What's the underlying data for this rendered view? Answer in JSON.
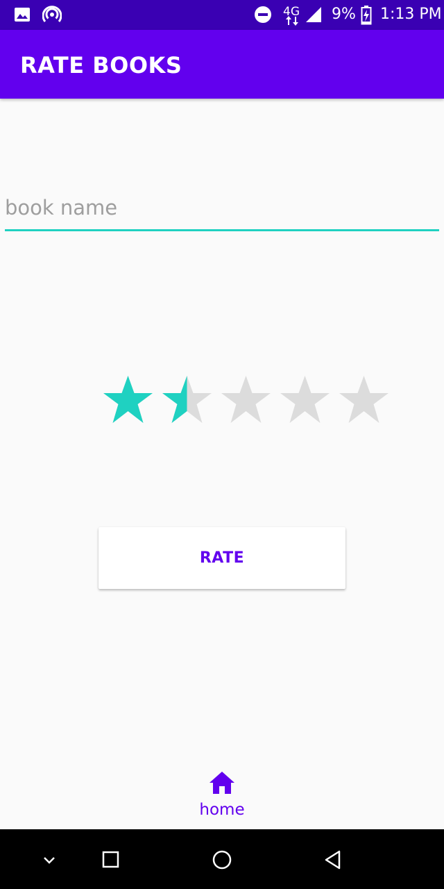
{
  "status_bar": {
    "network": "4G",
    "battery": "9%",
    "time": "1:13 PM",
    "icons": [
      "image-icon",
      "hotspot-icon",
      "do-not-disturb-icon",
      "network-4g-icon",
      "signal-icon",
      "battery-charging-icon"
    ]
  },
  "app_bar": {
    "title": "RATE BOOKS"
  },
  "book_field": {
    "value": "",
    "placeholder": "book name"
  },
  "rating": {
    "value": 1.5,
    "max": 5,
    "filled_color": "#1fd1c1",
    "empty_color": "#dcdcdc"
  },
  "rate_button": {
    "label": "RATE"
  },
  "bottom_nav": {
    "items": [
      {
        "label": "home",
        "icon": "home-icon",
        "active": true
      }
    ]
  },
  "system_nav": {
    "buttons": [
      "chevron-down-icon",
      "recents-icon",
      "home-circle-icon",
      "back-icon"
    ]
  },
  "colors": {
    "primary": "#6200ee",
    "primary_dark": "#3a00b3",
    "accent": "#1fd1c1",
    "background": "#fafafa"
  }
}
